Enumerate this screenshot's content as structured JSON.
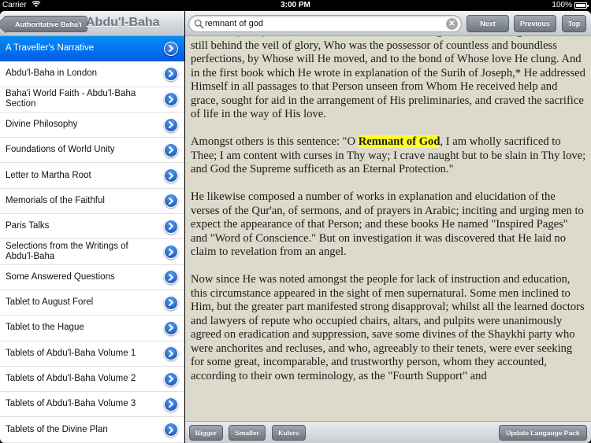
{
  "status_bar": {
    "carrier": "Carrier",
    "time": "3:00 PM",
    "battery": "100%"
  },
  "left_pane": {
    "back_button": "Authoritative Baha'i",
    "title": "Abdu'l-Baha",
    "items": [
      {
        "label": "A Traveller's Narrative",
        "selected": true
      },
      {
        "label": "Abdu'l-Baha in London"
      },
      {
        "label": "Baha'i World Faith - Abdu'l-Baha Section"
      },
      {
        "label": "Divine Philosophy"
      },
      {
        "label": "Foundations of World Unity"
      },
      {
        "label": "Letter to Martha Root"
      },
      {
        "label": "Memorials of the Faithful"
      },
      {
        "label": "Paris Talks"
      },
      {
        "label": "Selections from the Writings of Abdu'l-Baha"
      },
      {
        "label": "Some Answered Questions"
      },
      {
        "label": "Tablet to August Forel"
      },
      {
        "label": "Tablet to the Hague"
      },
      {
        "label": "Tablets of Abdu'l-Baha Volume 1"
      },
      {
        "label": "Tablets of Abdu'l-Baha Volume 2"
      },
      {
        "label": "Tablets of Abdu'l-Baha Volume 3"
      },
      {
        "label": "Tablets of the Divine Plan"
      }
    ]
  },
  "search": {
    "value": "remnant of god",
    "next": "Next",
    "previous": "Previous",
    "top": "Top"
  },
  "reader": {
    "paragraphs": [
      {
        "text": "term Bab [Gate] was this, that He was the channel of grace from some great Person still behind the veil of glory, Who was the possessor of countless and boundless perfections, by Whose will He moved, and to the bond of Whose love He clung. And in the first book which He wrote in explanation of the Surih of Joseph,* He addressed Himself in all passages to that Person unseen from Whom He received help and grace, sought for aid in the arrangement of His preliminaries, and craved the sacrifice of life in the way of His love."
      },
      {
        "before": "Amongst others is this sentence: \"O ",
        "highlight": "Remnant of God",
        "after": ", I am wholly sacrificed to Thee; I am content with curses in Thy way; I crave naught but to be slain in Thy love; and God the Supreme sufficeth as an Eternal Protection.\""
      },
      {
        "text": "He likewise composed a number of works in explanation and elucidation of the verses of the Qur'an, of sermons, and of prayers in Arabic; inciting and urging men to expect the appearance of that Person; and these books He named \"Inspired Pages\" and \"Word of Conscience.\" But on investigation it was discovered that He laid no claim to revelation from an angel."
      },
      {
        "text": "Now since He was noted amongst the people for lack of instruction and education, this circumstance appeared in the sight of men supernatural. Some men inclined to Him, but the greater part manifested strong disapproval; whilst all the learned doctors and lawyers of repute who occupied chairs, altars, and pulpits were unanimously agreed on eradication and suppression, save some divines of the Shaykhi party who were anchorites and recluses, and who, agreeably to their tenets, were ever seeking for some great, incomparable, and trustworthy person, whom they accounted, according to their own terminology, as the \"Fourth Support\" and"
      }
    ]
  },
  "bottom_bar": {
    "bigger": "Bigger",
    "smaller": "Smaller",
    "kulers": "Kulers",
    "update": "Update Langauge Pack"
  },
  "colors": {
    "selected_row": "#0a7bf0",
    "highlight": "#ffff22",
    "reader_bg": "#dcdacb"
  }
}
